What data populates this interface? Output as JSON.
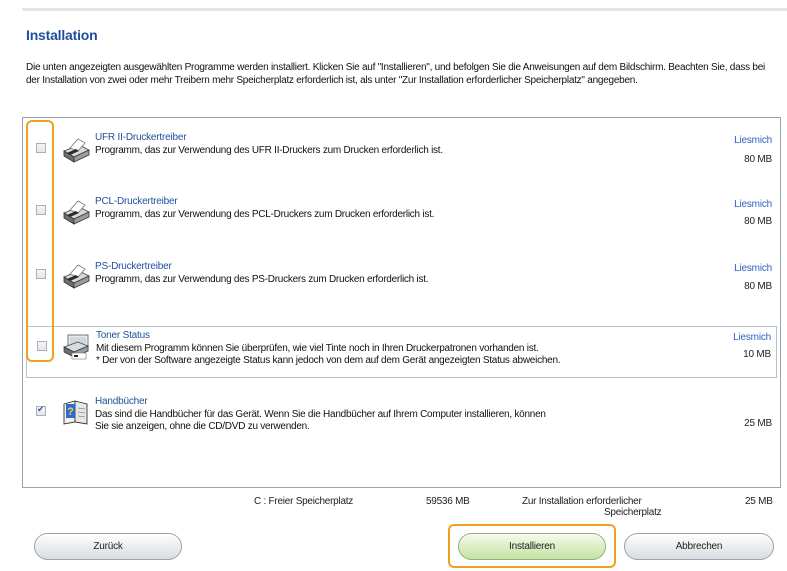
{
  "title": "Installation",
  "intro": "Die unten angezeigten ausgewählten Programme werden installiert. Klicken Sie auf \"Installieren\", und befolgen Sie die Anweisungen auf dem Bildschirm. Beachten Sie, dass bei der Installation von zwei oder mehr Treibern mehr Speicherplatz erforderlich ist, als unter \"Zur Installation erforderlicher Speicherplatz\" angegeben.",
  "programs": [
    {
      "name": "UFR II-Druckertreiber",
      "desc1": "Programm, das zur Verwendung des UFR II-Druckers zum Drucken erforderlich ist.",
      "desc2": "",
      "readme": "Liesmich",
      "size": "80 MB",
      "checked": false,
      "icon": "printer-icon"
    },
    {
      "name": "PCL-Druckertreiber",
      "desc1": "Programm, das zur Verwendung des PCL-Druckers zum Drucken erforderlich ist.",
      "desc2": "",
      "readme": "Liesmich",
      "size": "80 MB",
      "checked": false,
      "icon": "printer-icon"
    },
    {
      "name": "PS-Druckertreiber",
      "desc1": "Programm, das zur Verwendung des PS-Druckers zum Drucken erforderlich ist.",
      "desc2": "",
      "readme": "Liesmich",
      "size": "80 MB",
      "checked": false,
      "icon": "printer-icon"
    },
    {
      "name": "Toner Status",
      "desc1": "Mit diesem Programm können Sie überprüfen, wie viel Tinte noch in Ihren Druckerpatronen vorhanden ist.",
      "desc2": "* Der von der Software angezeigte Status kann jedoch von dem auf dem Gerät angezeigten Status abweichen.",
      "readme": "Liesmich",
      "size": "10 MB",
      "checked": false,
      "icon": "toner-status-icon"
    },
    {
      "name": "Handbücher",
      "desc1": "Das sind die Handbücher für das Gerät. Wenn Sie die Handbücher auf Ihrem Computer installieren, können",
      "desc2": "Sie sie anzeigen, ohne die CD/DVD zu verwenden.",
      "readme": "",
      "size": "25 MB",
      "checked": true,
      "icon": "help-book-icon"
    }
  ],
  "footer": {
    "free_label": "C : Freier Speicherplatz",
    "free_value": "59536 MB",
    "required_label_1": "Zur Installation erforderlicher",
    "required_label_2": "Speicherplatz",
    "required_value": "25 MB"
  },
  "buttons": {
    "back": "Zurück",
    "install": "Installieren",
    "cancel": "Abbrechen"
  },
  "colors": {
    "title": "#1f4f9c",
    "link": "#2d63c4",
    "highlight": "#f0a020"
  }
}
